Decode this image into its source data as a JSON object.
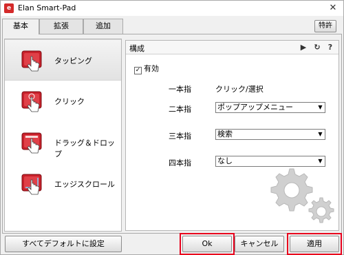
{
  "window": {
    "title": "Elan Smart-Pad",
    "close_glyph": "✕"
  },
  "tabs": [
    {
      "label": "基本",
      "active": true
    },
    {
      "label": "拡張",
      "active": false
    },
    {
      "label": "追加",
      "active": false
    }
  ],
  "patent_button": "特許",
  "sidebar": {
    "items": [
      {
        "label": "タッピング",
        "icon": "tapping-icon",
        "selected": true
      },
      {
        "label": "クリック",
        "icon": "click-icon",
        "selected": false
      },
      {
        "label": "ドラッグ＆ドロップ",
        "icon": "drag-drop-icon",
        "selected": false
      },
      {
        "label": "エッジスクロール",
        "icon": "edge-scroll-icon",
        "selected": false
      }
    ]
  },
  "panel": {
    "title": "構成",
    "header_icons": [
      "play-icon",
      "refresh-icon",
      "help-icon"
    ],
    "enabled_label": "有効",
    "enabled_checked": true,
    "rows": [
      {
        "label": "一本指",
        "value": "クリック/選択",
        "type": "text"
      },
      {
        "label": "二本指",
        "value": "ポップアップメニュー",
        "type": "dropdown"
      },
      {
        "label": "三本指",
        "value": "検索",
        "type": "dropdown"
      },
      {
        "label": "四本指",
        "value": "なし",
        "type": "dropdown"
      }
    ]
  },
  "buttons": {
    "reset_all": "すべてデフォルトに設定",
    "ok": "Ok",
    "cancel": "キャンセル",
    "apply": "適用"
  },
  "colors": {
    "highlight": "#e8001c",
    "icon_red": "#c8202a"
  }
}
